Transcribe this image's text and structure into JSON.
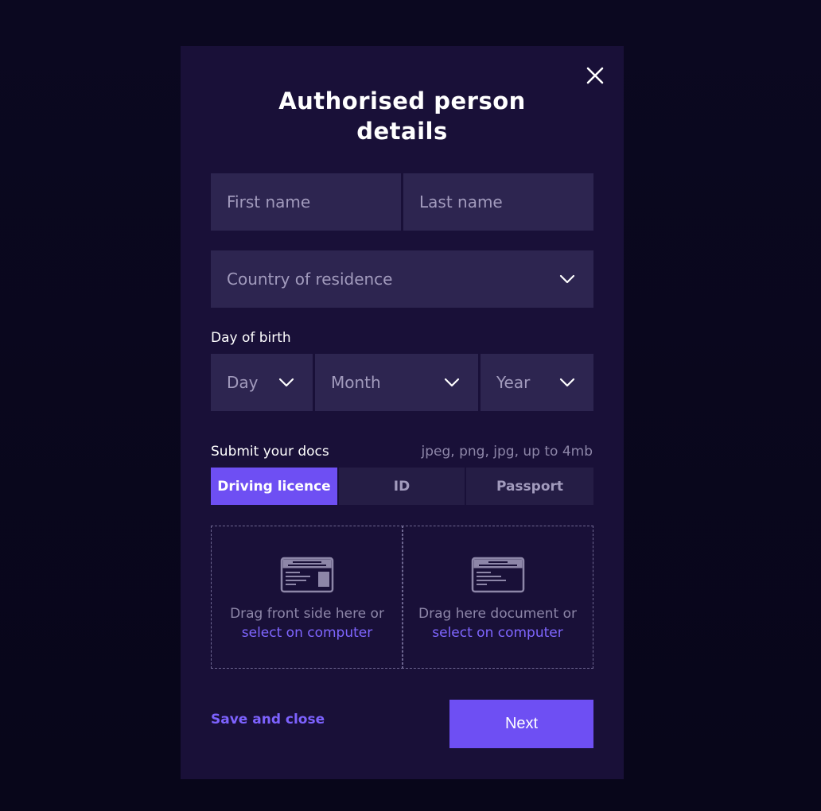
{
  "modal": {
    "title_line1": "Authorised person",
    "title_line2": "details"
  },
  "fields": {
    "first_name_placeholder": "First name",
    "last_name_placeholder": "Last name",
    "country_placeholder": "Country of residence"
  },
  "birth": {
    "label": "Day of birth",
    "day_placeholder": "Day",
    "month_placeholder": "Month",
    "year_placeholder": "Year"
  },
  "docs": {
    "label": "Submit your docs",
    "hint": "jpeg, png, jpg, up to 4mb",
    "tabs": [
      {
        "label": "Driving licence",
        "active": true
      },
      {
        "label": "ID",
        "active": false
      },
      {
        "label": "Passport",
        "active": false
      }
    ],
    "dropzones": [
      {
        "text": "Drag front side here or",
        "link": "select on computer",
        "icon": "id-card-icon"
      },
      {
        "text": "Drag here document or",
        "link": "select on computer",
        "icon": "document-card-icon"
      }
    ]
  },
  "footer": {
    "save_label": "Save and close",
    "next_label": "Next"
  },
  "colors": {
    "background": "#08061a",
    "modal": "#191038",
    "input": "#2d2550",
    "accent": "#6e4ff3",
    "link": "#7d62ff"
  }
}
